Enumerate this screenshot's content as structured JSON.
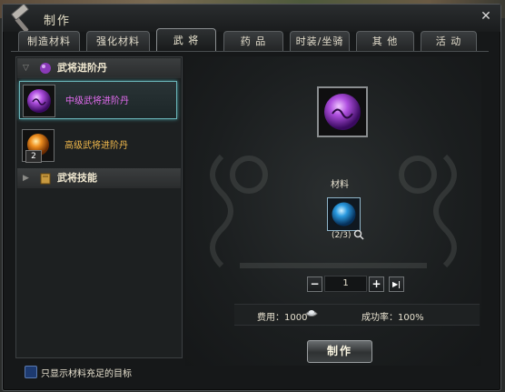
{
  "window": {
    "title": "制作",
    "close": "✕"
  },
  "tabs": [
    {
      "label": "制造材料"
    },
    {
      "label": "强化材料"
    },
    {
      "label": "武 将",
      "active": true
    },
    {
      "label": "药 品"
    },
    {
      "label": "时装/坐骑"
    },
    {
      "label": "其 他"
    },
    {
      "label": "活 动"
    }
  ],
  "recipe_list": {
    "groups": [
      {
        "label": "武将进阶丹",
        "expanded": true,
        "items": [
          {
            "label": "中级武将进阶丹",
            "selected": true,
            "color": "#e36cf0"
          },
          {
            "label": "高级武将进阶丹",
            "count": "2",
            "color": "#f0b84c"
          }
        ]
      },
      {
        "label": "武将技能",
        "expanded": false
      }
    ]
  },
  "craft": {
    "material_label": "材料",
    "material_count": "(2/3)",
    "quantity": "1",
    "minus": "−",
    "plus": "+",
    "max": "▶|",
    "fee_label": "费用：1000",
    "success_rate": "成功率：100%",
    "craft_button": "制作"
  },
  "footer": {
    "only_enough_materials": "只显示材料充足的目标"
  },
  "colors": {
    "accent_cyan": "#6ab4b8",
    "purple_item": "#e36cf0",
    "orange_item": "#f0b84c"
  }
}
